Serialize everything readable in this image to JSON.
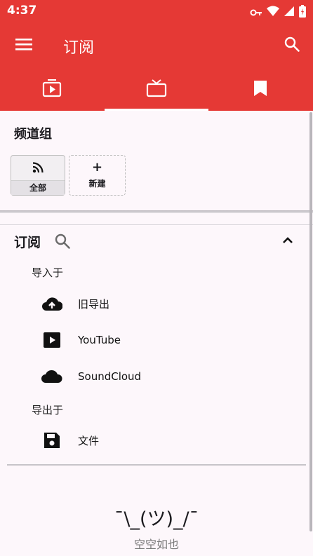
{
  "status_bar": {
    "time": "4:37"
  },
  "app_bar": {
    "title": "订阅"
  },
  "tabs": [
    {
      "icon": "play-video-icon",
      "active": false
    },
    {
      "icon": "tv-icon",
      "active": true
    },
    {
      "icon": "bookmark-icon",
      "active": false
    }
  ],
  "channel_groups": {
    "heading": "频道组",
    "all_label": "全部",
    "new_label": "新建",
    "new_plus": "+"
  },
  "subscriptions": {
    "heading": "订阅",
    "import_label": "导入于",
    "import_items": [
      {
        "icon": "cloud-upload-icon",
        "label": "旧导出"
      },
      {
        "icon": "youtube-icon",
        "label": "YouTube"
      },
      {
        "icon": "soundcloud-icon",
        "label": "SoundCloud"
      }
    ],
    "export_label": "导出于",
    "export_items": [
      {
        "icon": "save-icon",
        "label": "文件"
      }
    ]
  },
  "empty_state": {
    "emoticon": "¯\\_(ツ)_/¯",
    "text": "空空如也"
  },
  "colors": {
    "primary": "#e53935",
    "background": "#fdf7fb"
  }
}
